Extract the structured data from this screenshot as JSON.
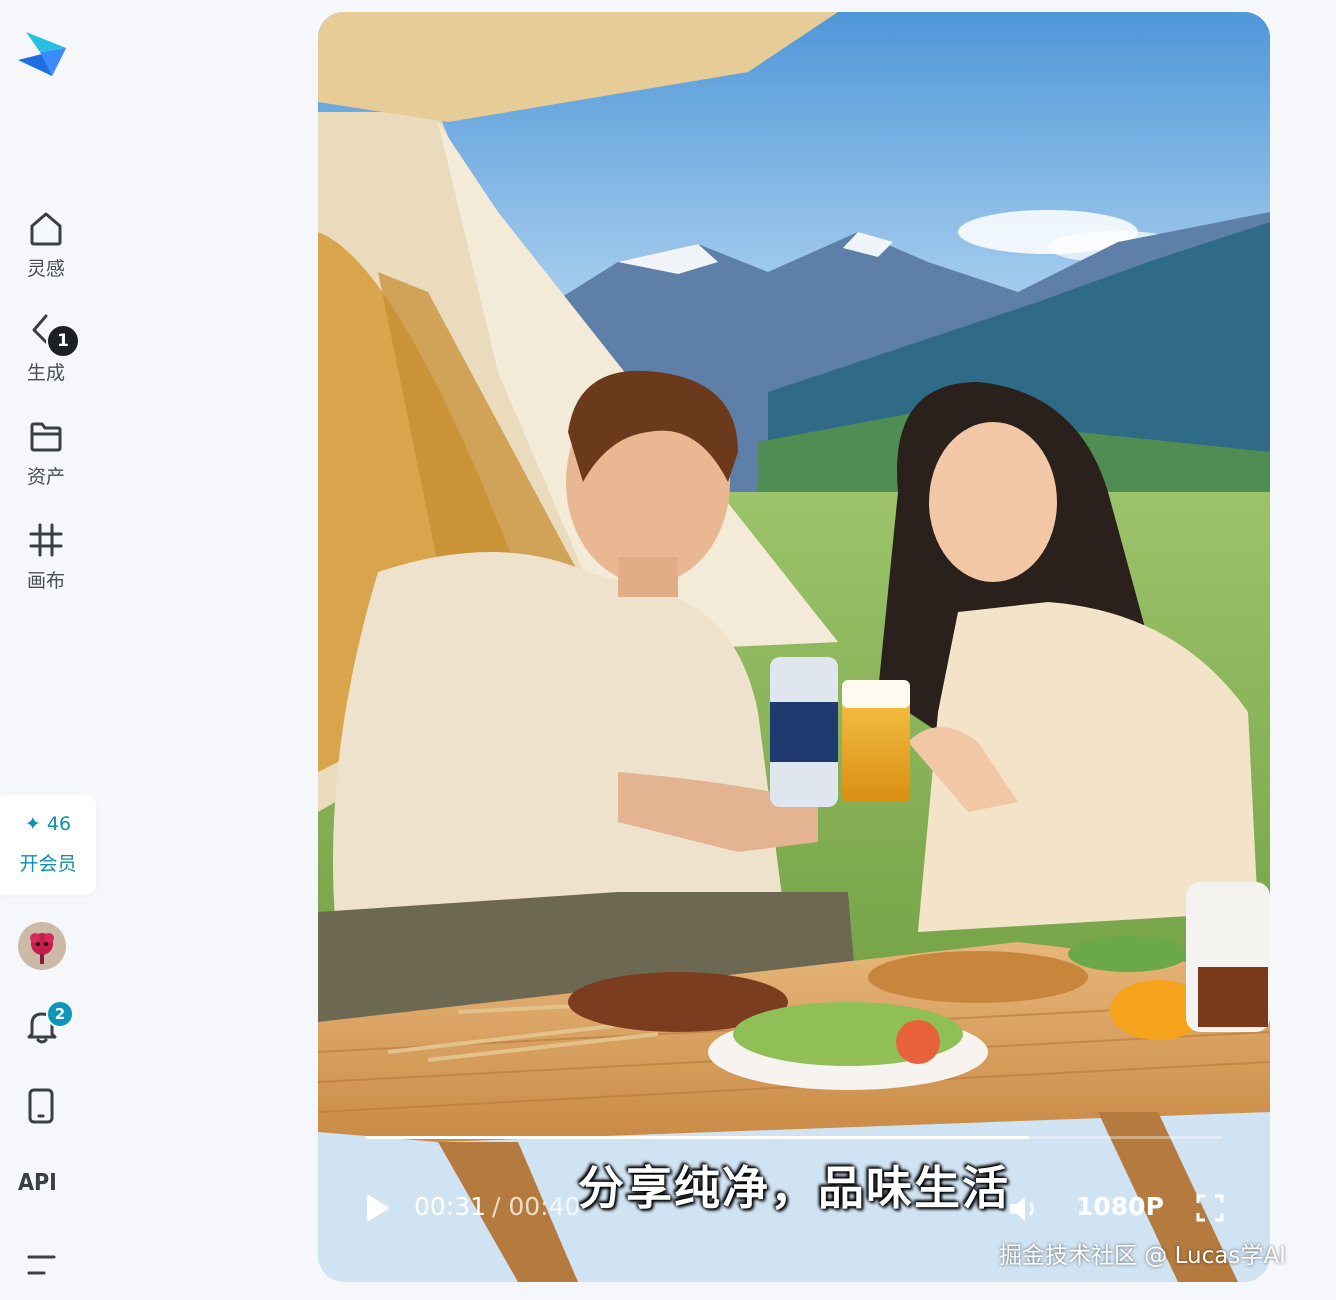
{
  "sidebar": {
    "nav": [
      {
        "label": "灵感",
        "icon": "home-icon"
      },
      {
        "label": "生成",
        "icon": "sparkle-arrow-icon",
        "badge": "1"
      },
      {
        "label": "资产",
        "icon": "folder-icon"
      },
      {
        "label": "画布",
        "icon": "canvas-icon"
      }
    ],
    "credits": {
      "icon": "sparkle-icon",
      "value": "46",
      "member_label": "开会员"
    },
    "notifications_badge": "2",
    "api_label": "API"
  },
  "player": {
    "subtitle": "分享纯净，品味生活",
    "time_current": "00:31",
    "time_total": "/ 00:40",
    "quality": "1080P",
    "progress": 0.775
  },
  "watermark": "掘金技术社区 @ Lucas学AI",
  "colors": {
    "accent": "#0d8fb0",
    "background": "#f5f7fa"
  }
}
